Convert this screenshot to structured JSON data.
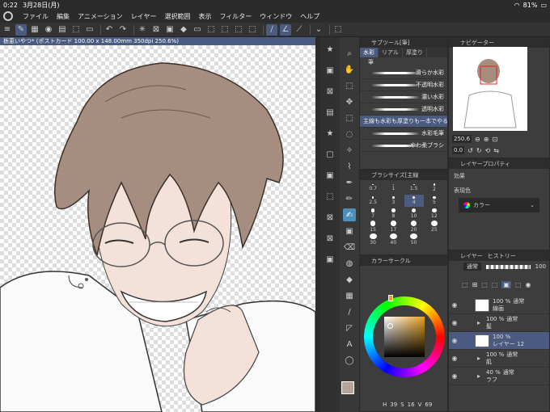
{
  "status": {
    "time": "0:22",
    "date": "3月28日(月)",
    "battery": "81%"
  },
  "menu": [
    "ファイル",
    "編集",
    "アニメーション",
    "レイヤー",
    "選択範囲",
    "表示",
    "フィルター",
    "ウィンドウ",
    "ヘルプ"
  ],
  "canvas_tab": "栃恵いやつ* (ポストカード 100.00 x 148.00mm 350dpi 250.6%)",
  "subtool": {
    "header": "サブツール[筆]",
    "tabs": [
      "水彩",
      "リアル",
      "厚塗り"
    ],
    "group": "筆",
    "brushes": [
      "滑らか水彩",
      "不透明水彩",
      "濃い水彩",
      "透明水彩",
      "主線も水彩も厚塗りも一本でやる",
      "水彩毛筆",
      "やわ柔ブラシ"
    ],
    "active_index": 4
  },
  "navigator": {
    "header": "ナビゲーター",
    "zoom": "250.6",
    "angle": "0.0"
  },
  "brush_size": {
    "header": "ブラシサイズ[主線",
    "sizes": [
      "0.7",
      "1",
      "1.5",
      "2",
      "2.5",
      "3",
      "4",
      "5",
      "7",
      "8",
      "10",
      "12",
      "15",
      "17",
      "20",
      "25",
      "30",
      "40",
      "50"
    ],
    "active_index": 6
  },
  "layer_property": {
    "header": "レイヤープロパティ",
    "effect_label": "効果",
    "expression_label": "表現色",
    "expression_value": "カラー"
  },
  "color_circle": {
    "header": "カラーサークル"
  },
  "layers": {
    "header": "レイヤー",
    "tab2": "ヒストリー",
    "blend": "通常",
    "opacity": "100",
    "items": [
      {
        "opacity": "100 %",
        "mode": "通常",
        "name": "線画",
        "type": "layer"
      },
      {
        "opacity": "100 %",
        "mode": "通常",
        "name": "髪",
        "type": "folder"
      },
      {
        "opacity": "100 %",
        "mode": "",
        "name": "レイヤー 12",
        "type": "layer"
      },
      {
        "opacity": "100 %",
        "mode": "通常",
        "name": "肌",
        "type": "folder"
      },
      {
        "opacity": "40 %",
        "mode": "通常",
        "name": "ラフ",
        "type": "folder"
      }
    ],
    "active_index": 2
  },
  "color_values": {
    "h": "39",
    "s": "16",
    "v": "69"
  }
}
